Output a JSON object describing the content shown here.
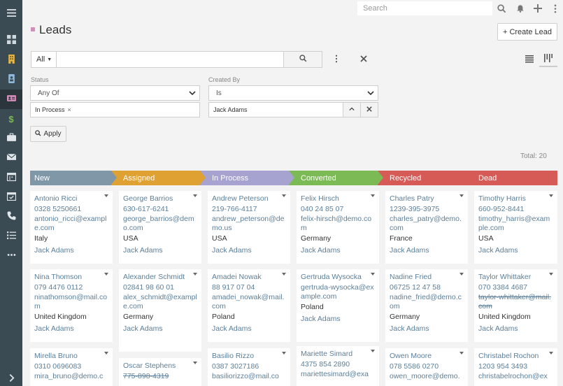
{
  "topbar": {
    "search_placeholder": "Search"
  },
  "header": {
    "title": "Leads",
    "create_label": "Create Lead"
  },
  "search": {
    "filter_scope": "All",
    "query": ""
  },
  "filters": {
    "status": {
      "label": "Status",
      "operator": "Any Of",
      "values": [
        "In Process"
      ]
    },
    "created_by": {
      "label": "Created By",
      "operator": "Is",
      "value": "Jack Adams"
    },
    "apply_label": "Apply"
  },
  "total": "Total: 20",
  "colors": {
    "new": "#7f97a6",
    "assigned": "#e0a133",
    "in_process": "#a6a3d0",
    "converted": "#7cba56",
    "recycled": "#d65a55",
    "dead": "#d65a55",
    "sidebar": "#3b4b54"
  },
  "columns": [
    {
      "title": "New",
      "cards": [
        {
          "name": "Antonio Ricci",
          "phone": "0328 5250661",
          "email": "antonio_ricci@example.com",
          "country": "Italy",
          "user": "Jack Adams"
        },
        {
          "name": "Nina Thomson",
          "phone": "079 4476 0112",
          "email": "ninathomson@mail.com",
          "country": "United Kingdom",
          "user": "Jack Adams"
        },
        {
          "name": "Mirella Bruno",
          "phone": "0310 0696083",
          "email": "mira_bruno@demo.c",
          "country": "",
          "user": ""
        }
      ]
    },
    {
      "title": "Assigned",
      "cards": [
        {
          "name": "George Barrios",
          "phone": "630-617-6241",
          "email": "george_barrios@demo.com",
          "country": "USA",
          "user": "Jack Adams"
        },
        {
          "name": "Alexander Schmidt",
          "phone": "02841 98 60 01",
          "email": "alex_schmidt@example.com",
          "country": "Germany",
          "user": "Jack Adams"
        },
        {
          "name": "Oscar Stephens",
          "phone": "775-898-4319",
          "email": "",
          "country": "",
          "user": ""
        }
      ]
    },
    {
      "title": "In Process",
      "cards": [
        {
          "name": "Andrew Peterson",
          "phone": "219-766-4117",
          "email": "andrew_peterson@demo.us",
          "country": "USA",
          "user": "Jack Adams"
        },
        {
          "name": "Amadei Nowak",
          "phone": "88 917 07 04",
          "email": "amadei_nowak@mail.com",
          "country": "Poland",
          "user": "Jack Adams"
        },
        {
          "name": "Basilio Rizzo",
          "phone": "0387 3027186",
          "email": "basiliorizzo@mail.co",
          "country": "",
          "user": ""
        }
      ]
    },
    {
      "title": "Converted",
      "cards": [
        {
          "name": "Felix Hirsch",
          "phone": "040 24 85 07",
          "email": "felix-hirsch@demo.com",
          "country": "Germany",
          "user": "Jack Adams"
        },
        {
          "name": "Gertruda Wysocka",
          "phone": "gertruda-wysocka@example.com",
          "email": "",
          "country": "Poland",
          "user": "Jack Adams"
        },
        {
          "name": "Mariette Simard",
          "phone": "4375 854 2890",
          "email": "mariettesimard@exa",
          "country": "",
          "user": ""
        }
      ]
    },
    {
      "title": "Recycled",
      "cards": [
        {
          "name": "Charles Patry",
          "phone": "1239-395-3975",
          "email": "charles_patry@demo.com",
          "country": "France",
          "user": "Jack Adams"
        },
        {
          "name": "Nadine Fried",
          "phone": "06725 12 47 58",
          "email": "nadine_fried@demo.com",
          "country": "Germany",
          "user": "Jack Adams"
        },
        {
          "name": "Owen Moore",
          "phone": "078 5586 0270",
          "email": "owen_moore@demo.",
          "country": "",
          "user": ""
        }
      ]
    },
    {
      "title": "Dead",
      "cards": [
        {
          "name": "Timothy Harris",
          "phone": "660-952-8441",
          "email": "timothy_harris@example.com",
          "country": "USA",
          "user": "Jack Adams"
        },
        {
          "name": "Taylor Whittaker",
          "phone": "070 3384 4687",
          "email": "taylor-whittaker@mail.com",
          "country": "United Kingdom",
          "user": "Jack Adams"
        },
        {
          "name": "Christabel Rochon",
          "phone": "1203 954 3493",
          "email": "christabelrochon@ex",
          "country": "",
          "user": ""
        }
      ]
    }
  ]
}
